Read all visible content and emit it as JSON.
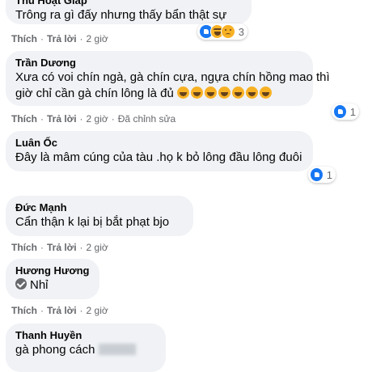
{
  "actions": {
    "like": "Thích",
    "reply": "Trả lời",
    "dot": "·"
  },
  "comments": [
    {
      "author": "Thu Hoạt Giáp",
      "text": "Trông ra gì đấy nhưng thấy bẩn thật sự",
      "time": "2 giờ",
      "reactions": {
        "icons": [
          "like-icon",
          "haha-icon",
          "sad-icon"
        ],
        "count": "3"
      }
    },
    {
      "author": "Trần Dương",
      "text_line1": "Xưa có voi chín ngà, gà chín cựa, ngựa chín hồng mao thì",
      "text_line2": "giờ chỉ cần gà chín lông là đủ",
      "time": "2 giờ",
      "edited": "Đã chỉnh sửa",
      "reactions": {
        "icons": [
          "like-icon"
        ],
        "count": "1"
      }
    },
    {
      "author": "Luân Ốc",
      "text": "Đây là mâm cúng của tàu .họ k bỏ lông đầu lông đuôi",
      "reactions": {
        "icons": [
          "like-icon"
        ],
        "count": "1"
      }
    },
    {
      "author": "Đức Mạnh",
      "text": "Cẩn thận k lại bị bắt phạt bjo",
      "time": "2 giờ"
    },
    {
      "author": "Hương Hương",
      "text": "Nhỉ",
      "time": "2 giờ"
    },
    {
      "author": "Thanh Huyền",
      "text": "gà phong cách"
    }
  ]
}
